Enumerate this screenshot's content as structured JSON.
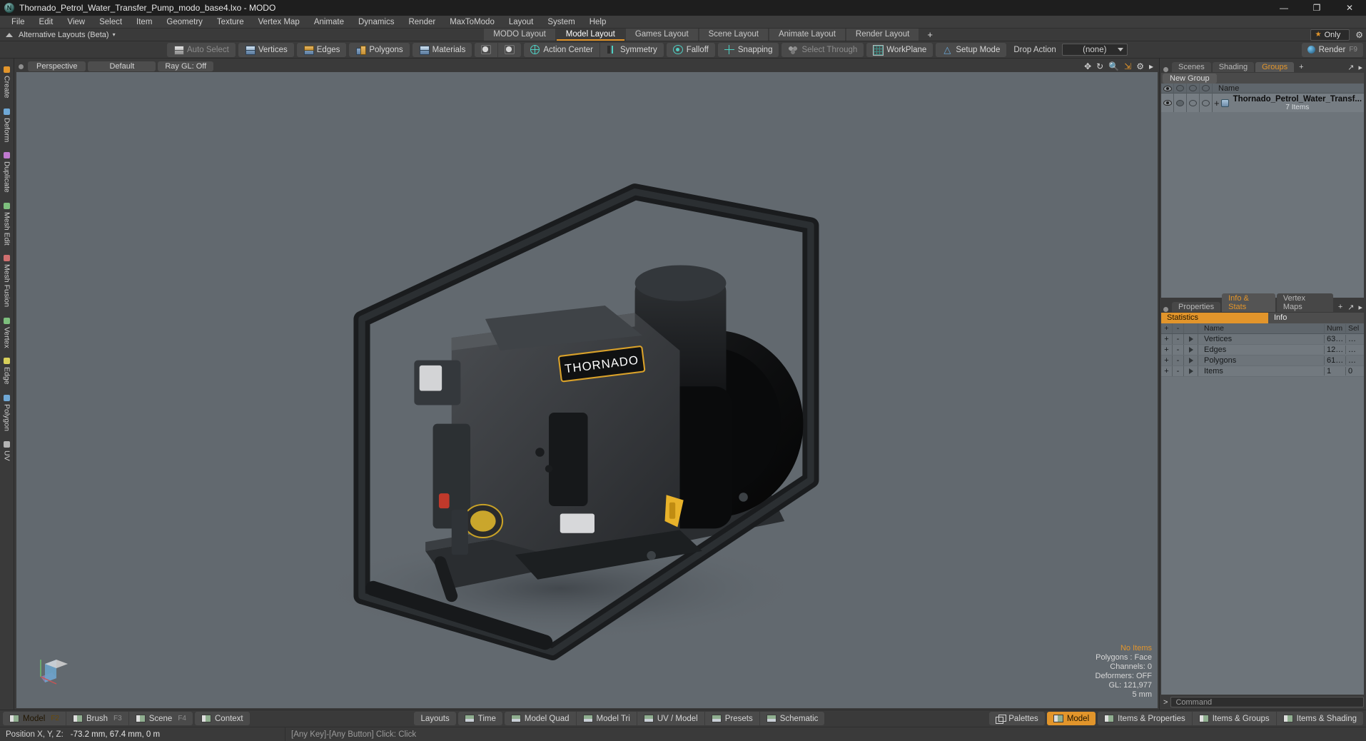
{
  "titlebar": {
    "app_icon": "modo-logo-icon",
    "title": "Thornado_Petrol_Water_Transfer_Pump_modo_base4.lxo - MODO",
    "minimize": "—",
    "maximize": "❐",
    "close": "✕"
  },
  "menubar": {
    "items": [
      {
        "label": "File"
      },
      {
        "label": "Edit"
      },
      {
        "label": "View"
      },
      {
        "label": "Select"
      },
      {
        "label": "Item"
      },
      {
        "label": "Geometry"
      },
      {
        "label": "Texture"
      },
      {
        "label": "Vertex Map"
      },
      {
        "label": "Animate"
      },
      {
        "label": "Dynamics"
      },
      {
        "label": "Render"
      },
      {
        "label": "MaxToModo"
      },
      {
        "label": "Layout"
      },
      {
        "label": "System"
      },
      {
        "label": "Help"
      }
    ]
  },
  "layoutrow": {
    "alt_layouts_label": "Alternative Layouts (Beta)",
    "alt_layouts_arrow": "▾",
    "tabs": [
      {
        "label": "MODO Layout",
        "active": false
      },
      {
        "label": "Model Layout",
        "active": true
      },
      {
        "label": "Games Layout",
        "active": false
      },
      {
        "label": "Scene Layout",
        "active": false
      },
      {
        "label": "Animate Layout",
        "active": false
      },
      {
        "label": "Render Layout",
        "active": false
      }
    ],
    "add_tab": "+",
    "only_star": "★",
    "only_label": "Only",
    "gear": "⚙"
  },
  "toolbar": {
    "selection_modes": [
      {
        "label": "Auto Select",
        "icon": "cube-grey-icon",
        "dim": true
      },
      {
        "label": "Vertices",
        "icon": "cube-vertices-icon",
        "dim": false
      },
      {
        "label": "Edges",
        "icon": "cube-edges-icon",
        "dim": false
      },
      {
        "label": "Polygons",
        "icon": "cube-polygons-icon",
        "dim": false
      },
      {
        "label": "Materials",
        "icon": "cube-materials-icon",
        "dim": false
      }
    ],
    "extra_icons": [
      "material-sphere-a-icon",
      "material-sphere-b-icon"
    ],
    "options": [
      {
        "label": "Action Center",
        "icon": "action-center-icon",
        "dim": false
      },
      {
        "label": "Symmetry",
        "icon": "symmetry-icon",
        "dim": false
      },
      {
        "label": "Falloff",
        "icon": "falloff-icon",
        "dim": false
      },
      {
        "label": "Snapping",
        "icon": "snapping-icon",
        "dim": false
      },
      {
        "label": "Select Through",
        "icon": "select-through-icon",
        "dim": true
      },
      {
        "label": "WorkPlane",
        "icon": "workplane-icon",
        "dim": false
      },
      {
        "label": "Setup Mode",
        "icon": "setup-mode-icon",
        "dim": false
      }
    ],
    "drop_action_label": "Drop Action",
    "drop_action_value": "(none)",
    "render_label": "Render",
    "render_shortcut": "F9"
  },
  "leftrail": {
    "items": [
      {
        "label": "Create",
        "color": "#e2952b"
      },
      {
        "label": "Deform",
        "color": "#6fa8d6"
      },
      {
        "label": "Duplicate",
        "color": "#c07ad0"
      },
      {
        "label": "Mesh Edit",
        "color": "#7dbf7d"
      },
      {
        "label": "Mesh Fusion",
        "color": "#d06f6f"
      },
      {
        "label": "Vertex",
        "color": "#7dbf7d"
      },
      {
        "label": "Edge",
        "color": "#d8d05a"
      },
      {
        "label": "Polygon",
        "color": "#6fa8d6"
      },
      {
        "label": "UV",
        "color": "#b5b5b5"
      }
    ]
  },
  "viewport": {
    "tabs": [
      {
        "label": "Perspective"
      },
      {
        "label": "Default"
      },
      {
        "label": "Ray GL: Off"
      }
    ],
    "header_icons": [
      "move-icon",
      "rotate-icon",
      "zoom-icon",
      "fit-icon",
      "gear-icon",
      "chevron-right-icon"
    ],
    "stats": {
      "no_items": "No Items",
      "polygons": "Polygons : Face",
      "channels": "Channels: 0",
      "deformers": "Deformers: OFF",
      "gl": "GL: 121,977",
      "grid": "5 mm"
    },
    "model_label": "THORNADO"
  },
  "rightpanel": {
    "tabs": [
      {
        "label": "Scenes",
        "active": false
      },
      {
        "label": "Shading",
        "active": false
      },
      {
        "label": "Groups",
        "active": true
      },
      {
        "label": "+",
        "active": false
      }
    ],
    "tabs_right": [
      "expand-icon",
      "chevron-right-icon"
    ],
    "new_group_button": "New Group",
    "group_list": {
      "columns": [
        "visible-eye-icon",
        "render-icon",
        "wireframe-icon",
        "shading-icon",
        "Name"
      ],
      "rows": [
        {
          "name": "Thornado_Petrol_Water_Transf...",
          "sub": "7 Items",
          "expander": "+"
        }
      ]
    },
    "stats_panel": {
      "tabs": [
        {
          "label": "Properties",
          "active": false
        },
        {
          "label": "Info & Stats",
          "active": true
        },
        {
          "label": "Vertex Maps",
          "active": false
        },
        {
          "label": "+",
          "active": false
        }
      ],
      "segments": [
        {
          "label": "Statistics",
          "active": true
        },
        {
          "label": "Info",
          "active": false
        }
      ],
      "columns": {
        "plus": "+",
        "minus": "-",
        "name": "Name",
        "num": "Num",
        "sel": "Sel"
      },
      "rows": [
        {
          "plus": "+",
          "minus": "-",
          "name": "Vertices",
          "num": "63…",
          "sel": "…"
        },
        {
          "plus": "+",
          "minus": "-",
          "name": "Edges",
          "num": "12…",
          "sel": "…"
        },
        {
          "plus": "+",
          "minus": "-",
          "name": "Polygons",
          "num": "61…",
          "sel": "…"
        },
        {
          "plus": "+",
          "minus": "-",
          "name": "Items",
          "num": "1",
          "sel": "0"
        }
      ]
    },
    "command_prompt": ">",
    "command_placeholder": "Command"
  },
  "bottombar": {
    "left_modes": [
      {
        "label": "Model",
        "fkey": "F2",
        "active": true
      },
      {
        "label": "Brush",
        "fkey": "F3",
        "active": false
      },
      {
        "label": "Scene",
        "fkey": "F4",
        "active": false
      }
    ],
    "context_label": "Context",
    "center": [
      {
        "label": "Layouts",
        "icon": null
      },
      {
        "label": "Time",
        "icon": "time-icon"
      },
      {
        "label": "Model Quad",
        "icon": "model-quad-icon"
      },
      {
        "label": "Model Tri",
        "icon": "model-tri-icon"
      },
      {
        "label": "UV / Model",
        "icon": "uv-model-icon"
      },
      {
        "label": "Presets",
        "icon": "presets-icon"
      },
      {
        "label": "Schematic",
        "icon": "schematic-icon"
      }
    ],
    "right": [
      {
        "label": "Palettes",
        "icon": "palettes-icon",
        "active": false
      },
      {
        "label": "Model",
        "icon": "model-icon",
        "active": true
      },
      {
        "label": "Items & Properties",
        "icon": "items-properties-icon",
        "active": false
      },
      {
        "label": "Items & Groups",
        "icon": "items-groups-icon",
        "active": false
      },
      {
        "label": "Items & Shading",
        "icon": "items-shading-icon",
        "active": false
      }
    ]
  },
  "statusbar": {
    "position_label": "Position X, Y, Z:",
    "position_value": "-73.2 mm, 67.4 mm, 0 m",
    "hint": "[Any Key]-[Any Button] Click:   Click"
  },
  "colors": {
    "accent": "#e2952b",
    "panel_bg": "#3a3a3a",
    "viewport_bg": "#62696f",
    "list_bg": "#6d747a"
  }
}
